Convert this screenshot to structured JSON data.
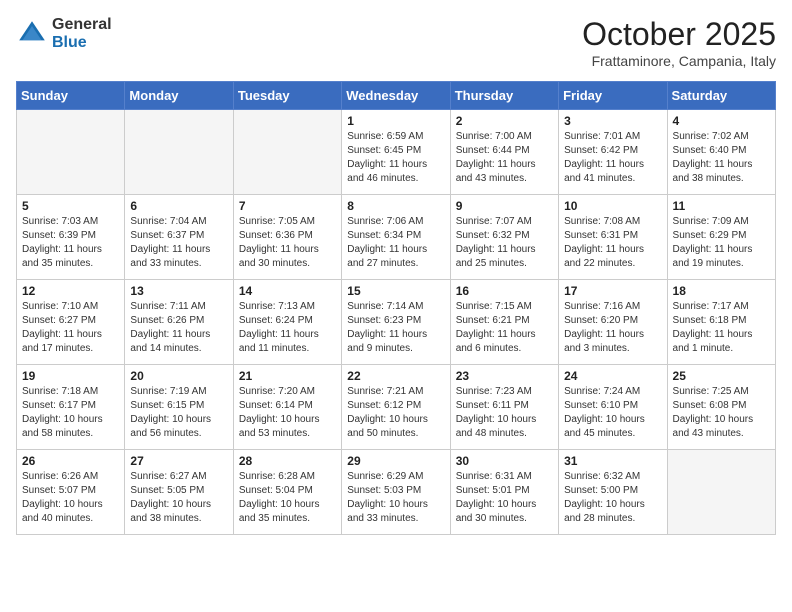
{
  "header": {
    "logo_general": "General",
    "logo_blue": "Blue",
    "month": "October 2025",
    "location": "Frattaminore, Campania, Italy"
  },
  "days_of_week": [
    "Sunday",
    "Monday",
    "Tuesday",
    "Wednesday",
    "Thursday",
    "Friday",
    "Saturday"
  ],
  "weeks": [
    [
      {
        "day": "",
        "info": ""
      },
      {
        "day": "",
        "info": ""
      },
      {
        "day": "",
        "info": ""
      },
      {
        "day": "1",
        "info": "Sunrise: 6:59 AM\nSunset: 6:45 PM\nDaylight: 11 hours\nand 46 minutes."
      },
      {
        "day": "2",
        "info": "Sunrise: 7:00 AM\nSunset: 6:44 PM\nDaylight: 11 hours\nand 43 minutes."
      },
      {
        "day": "3",
        "info": "Sunrise: 7:01 AM\nSunset: 6:42 PM\nDaylight: 11 hours\nand 41 minutes."
      },
      {
        "day": "4",
        "info": "Sunrise: 7:02 AM\nSunset: 6:40 PM\nDaylight: 11 hours\nand 38 minutes."
      }
    ],
    [
      {
        "day": "5",
        "info": "Sunrise: 7:03 AM\nSunset: 6:39 PM\nDaylight: 11 hours\nand 35 minutes."
      },
      {
        "day": "6",
        "info": "Sunrise: 7:04 AM\nSunset: 6:37 PM\nDaylight: 11 hours\nand 33 minutes."
      },
      {
        "day": "7",
        "info": "Sunrise: 7:05 AM\nSunset: 6:36 PM\nDaylight: 11 hours\nand 30 minutes."
      },
      {
        "day": "8",
        "info": "Sunrise: 7:06 AM\nSunset: 6:34 PM\nDaylight: 11 hours\nand 27 minutes."
      },
      {
        "day": "9",
        "info": "Sunrise: 7:07 AM\nSunset: 6:32 PM\nDaylight: 11 hours\nand 25 minutes."
      },
      {
        "day": "10",
        "info": "Sunrise: 7:08 AM\nSunset: 6:31 PM\nDaylight: 11 hours\nand 22 minutes."
      },
      {
        "day": "11",
        "info": "Sunrise: 7:09 AM\nSunset: 6:29 PM\nDaylight: 11 hours\nand 19 minutes."
      }
    ],
    [
      {
        "day": "12",
        "info": "Sunrise: 7:10 AM\nSunset: 6:27 PM\nDaylight: 11 hours\nand 17 minutes."
      },
      {
        "day": "13",
        "info": "Sunrise: 7:11 AM\nSunset: 6:26 PM\nDaylight: 11 hours\nand 14 minutes."
      },
      {
        "day": "14",
        "info": "Sunrise: 7:13 AM\nSunset: 6:24 PM\nDaylight: 11 hours\nand 11 minutes."
      },
      {
        "day": "15",
        "info": "Sunrise: 7:14 AM\nSunset: 6:23 PM\nDaylight: 11 hours\nand 9 minutes."
      },
      {
        "day": "16",
        "info": "Sunrise: 7:15 AM\nSunset: 6:21 PM\nDaylight: 11 hours\nand 6 minutes."
      },
      {
        "day": "17",
        "info": "Sunrise: 7:16 AM\nSunset: 6:20 PM\nDaylight: 11 hours\nand 3 minutes."
      },
      {
        "day": "18",
        "info": "Sunrise: 7:17 AM\nSunset: 6:18 PM\nDaylight: 11 hours\nand 1 minute."
      }
    ],
    [
      {
        "day": "19",
        "info": "Sunrise: 7:18 AM\nSunset: 6:17 PM\nDaylight: 10 hours\nand 58 minutes."
      },
      {
        "day": "20",
        "info": "Sunrise: 7:19 AM\nSunset: 6:15 PM\nDaylight: 10 hours\nand 56 minutes."
      },
      {
        "day": "21",
        "info": "Sunrise: 7:20 AM\nSunset: 6:14 PM\nDaylight: 10 hours\nand 53 minutes."
      },
      {
        "day": "22",
        "info": "Sunrise: 7:21 AM\nSunset: 6:12 PM\nDaylight: 10 hours\nand 50 minutes."
      },
      {
        "day": "23",
        "info": "Sunrise: 7:23 AM\nSunset: 6:11 PM\nDaylight: 10 hours\nand 48 minutes."
      },
      {
        "day": "24",
        "info": "Sunrise: 7:24 AM\nSunset: 6:10 PM\nDaylight: 10 hours\nand 45 minutes."
      },
      {
        "day": "25",
        "info": "Sunrise: 7:25 AM\nSunset: 6:08 PM\nDaylight: 10 hours\nand 43 minutes."
      }
    ],
    [
      {
        "day": "26",
        "info": "Sunrise: 6:26 AM\nSunset: 5:07 PM\nDaylight: 10 hours\nand 40 minutes."
      },
      {
        "day": "27",
        "info": "Sunrise: 6:27 AM\nSunset: 5:05 PM\nDaylight: 10 hours\nand 38 minutes."
      },
      {
        "day": "28",
        "info": "Sunrise: 6:28 AM\nSunset: 5:04 PM\nDaylight: 10 hours\nand 35 minutes."
      },
      {
        "day": "29",
        "info": "Sunrise: 6:29 AM\nSunset: 5:03 PM\nDaylight: 10 hours\nand 33 minutes."
      },
      {
        "day": "30",
        "info": "Sunrise: 6:31 AM\nSunset: 5:01 PM\nDaylight: 10 hours\nand 30 minutes."
      },
      {
        "day": "31",
        "info": "Sunrise: 6:32 AM\nSunset: 5:00 PM\nDaylight: 10 hours\nand 28 minutes."
      },
      {
        "day": "",
        "info": ""
      }
    ]
  ]
}
